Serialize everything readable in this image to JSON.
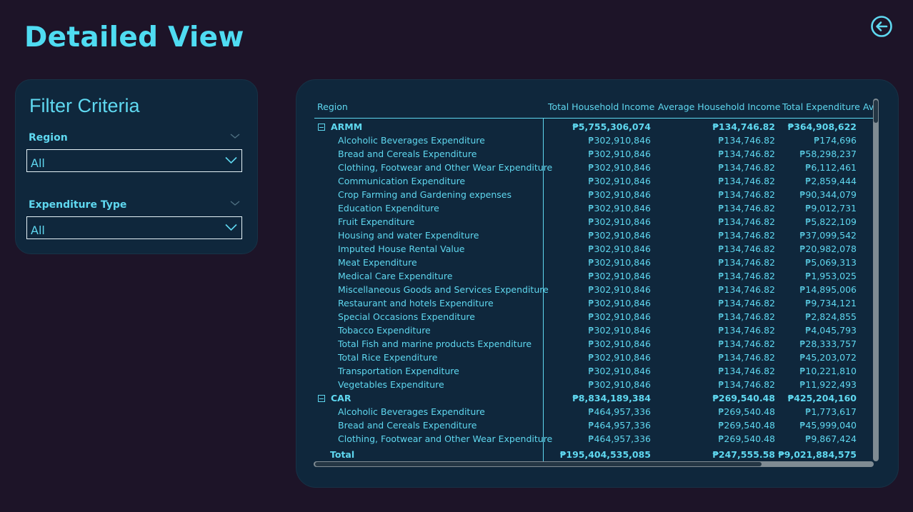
{
  "page": {
    "title": "Detailed View"
  },
  "filter": {
    "title": "Filter Criteria",
    "region": {
      "label": "Region",
      "value": "All"
    },
    "expenditure": {
      "label": "Expenditure Type",
      "value": "All"
    }
  },
  "table": {
    "columns": [
      "Region",
      "Total Household Income",
      "Average Household Income",
      "Total Expenditure",
      "Av"
    ],
    "groups": [
      {
        "name": "ARMM",
        "values": [
          "₱5,755,306,074",
          "₱134,746.82",
          "₱364,908,622"
        ],
        "rows": [
          {
            "label": "Alcoholic Beverages Expenditure",
            "values": [
              "₱302,910,846",
              "₱134,746.82",
              "₱174,696"
            ]
          },
          {
            "label": "Bread and Cereals Expenditure",
            "values": [
              "₱302,910,846",
              "₱134,746.82",
              "₱58,298,237"
            ]
          },
          {
            "label": "Clothing, Footwear and Other Wear Expenditure",
            "values": [
              "₱302,910,846",
              "₱134,746.82",
              "₱6,112,461"
            ]
          },
          {
            "label": "Communication Expenditure",
            "values": [
              "₱302,910,846",
              "₱134,746.82",
              "₱2,859,444"
            ]
          },
          {
            "label": "Crop Farming and Gardening expenses",
            "values": [
              "₱302,910,846",
              "₱134,746.82",
              "₱90,344,079"
            ]
          },
          {
            "label": "Education Expenditure",
            "values": [
              "₱302,910,846",
              "₱134,746.82",
              "₱9,012,731"
            ]
          },
          {
            "label": "Fruit Expenditure",
            "values": [
              "₱302,910,846",
              "₱134,746.82",
              "₱5,822,109"
            ]
          },
          {
            "label": "Housing and water Expenditure",
            "values": [
              "₱302,910,846",
              "₱134,746.82",
              "₱37,099,542"
            ]
          },
          {
            "label": "Imputed House Rental Value",
            "values": [
              "₱302,910,846",
              "₱134,746.82",
              "₱20,982,078"
            ]
          },
          {
            "label": "Meat Expenditure",
            "values": [
              "₱302,910,846",
              "₱134,746.82",
              "₱5,069,313"
            ]
          },
          {
            "label": "Medical Care Expenditure",
            "values": [
              "₱302,910,846",
              "₱134,746.82",
              "₱1,953,025"
            ]
          },
          {
            "label": "Miscellaneous Goods and Services Expenditure",
            "values": [
              "₱302,910,846",
              "₱134,746.82",
              "₱14,895,006"
            ]
          },
          {
            "label": "Restaurant and hotels Expenditure",
            "values": [
              "₱302,910,846",
              "₱134,746.82",
              "₱9,734,121"
            ]
          },
          {
            "label": "Special Occasions Expenditure",
            "values": [
              "₱302,910,846",
              "₱134,746.82",
              "₱2,824,855"
            ]
          },
          {
            "label": "Tobacco Expenditure",
            "values": [
              "₱302,910,846",
              "₱134,746.82",
              "₱4,045,793"
            ]
          },
          {
            "label": "Total Fish and marine products Expenditure",
            "values": [
              "₱302,910,846",
              "₱134,746.82",
              "₱28,333,757"
            ]
          },
          {
            "label": "Total Rice Expenditure",
            "values": [
              "₱302,910,846",
              "₱134,746.82",
              "₱45,203,072"
            ]
          },
          {
            "label": "Transportation Expenditure",
            "values": [
              "₱302,910,846",
              "₱134,746.82",
              "₱10,221,810"
            ]
          },
          {
            "label": "Vegetables Expenditure",
            "values": [
              "₱302,910,846",
              "₱134,746.82",
              "₱11,922,493"
            ]
          }
        ]
      },
      {
        "name": "CAR",
        "values": [
          "₱8,834,189,384",
          "₱269,540.48",
          "₱425,204,160"
        ],
        "rows": [
          {
            "label": "Alcoholic Beverages Expenditure",
            "values": [
              "₱464,957,336",
              "₱269,540.48",
              "₱1,773,617"
            ]
          },
          {
            "label": "Bread and Cereals Expenditure",
            "values": [
              "₱464,957,336",
              "₱269,540.48",
              "₱45,999,040"
            ]
          },
          {
            "label": "Clothing, Footwear and Other Wear Expenditure",
            "values": [
              "₱464,957,336",
              "₱269,540.48",
              "₱9,867,424"
            ]
          }
        ]
      }
    ],
    "total": {
      "label": "Total",
      "values": [
        "₱195,404,535,085",
        "₱247,555.58",
        "₱9,021,884,575"
      ]
    }
  },
  "icons": {
    "back": "back-arrow-circle-icon",
    "expander": "collapse-minus-icon",
    "dropdown": "chevron-down-icon"
  },
  "colors": {
    "background": "#1d1428",
    "panel": "#0f273c",
    "accent": "#5fd8f0",
    "title": "#4fdcf2"
  }
}
